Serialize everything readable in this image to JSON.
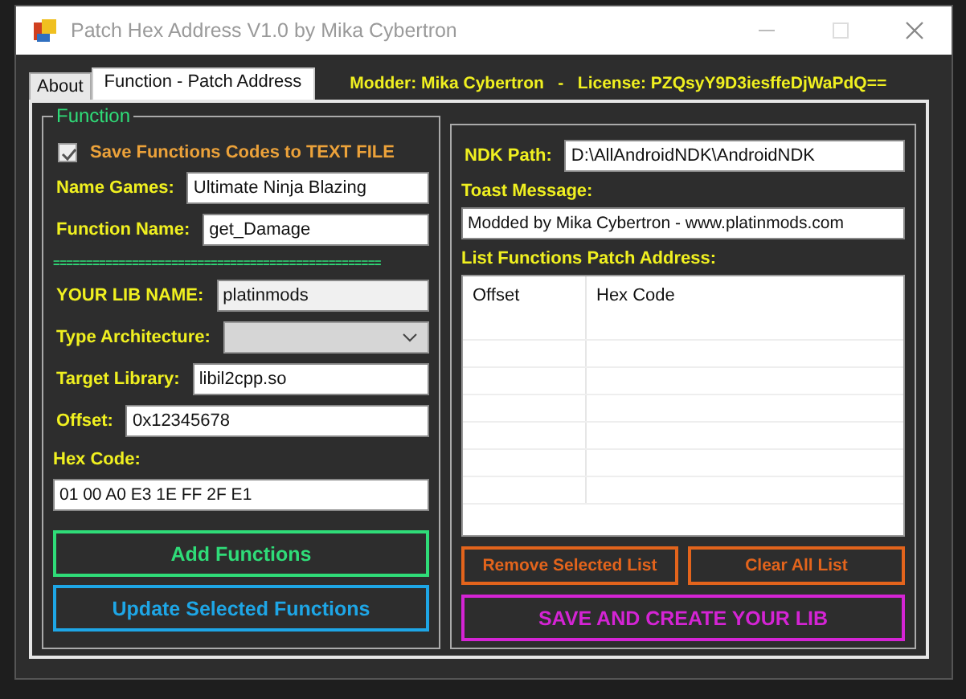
{
  "window": {
    "title": "Patch Hex Address V1.0 by Mika Cybertron"
  },
  "tabs": [
    {
      "label": "About",
      "selected": false
    },
    {
      "label": "Function - Patch Address",
      "selected": true
    }
  ],
  "header_text": "Modder: Mika Cybertron   -   License: PZQsyY9D3iesffeDjWaPdQ==",
  "function_group": {
    "legend": "Function",
    "save_checkbox": {
      "label": "Save Functions Codes to TEXT FILE",
      "checked": true
    },
    "rows": [
      {
        "kind": "field",
        "label": "Name Games:",
        "value": "Ultimate Ninja Blazing",
        "readonly": false
      },
      {
        "kind": "field",
        "label": "Function Name:",
        "value": "get_Damage",
        "readonly": false
      },
      {
        "kind": "separator",
        "text": "=================================================="
      },
      {
        "kind": "field",
        "label": "YOUR LIB NAME:",
        "value": "platinmods",
        "readonly": true
      },
      {
        "kind": "combo",
        "label": "Type Architecture:",
        "disabled": true
      },
      {
        "kind": "field",
        "label": "Target Library:",
        "value": "libil2cpp.so",
        "readonly": false
      },
      {
        "kind": "field",
        "label": "Offset:",
        "value": "0x12345678",
        "readonly": false
      },
      {
        "kind": "stacked",
        "label": "Hex Code:",
        "value": "01 00 A0 E3 1E FF 2F E1",
        "readonly": false
      }
    ],
    "buttons": [
      {
        "label": "Add Functions",
        "color": "#2fdc78"
      },
      {
        "label": "Update Selected Functions",
        "color": "#1ea6e6"
      }
    ]
  },
  "right_panel": {
    "rows": [
      {
        "kind": "field",
        "label": "NDK Path:",
        "value": "D:\\AllAndroidNDK\\AndroidNDK",
        "readonly": false
      },
      {
        "kind": "stacked",
        "label": "Toast Message:",
        "value": "Modded by Mika Cybertron - www.platinmods.com",
        "readonly": false
      }
    ],
    "list_label": "List Functions Patch Address:",
    "table": {
      "columns": [
        "Offset",
        "Hex Code"
      ]
    },
    "buttons": [
      {
        "label": "Remove Selected List",
        "color": "#e3641c"
      },
      {
        "label": "Clear All List",
        "color": "#e3641c"
      }
    ],
    "save_button": {
      "label": "SAVE AND CREATE YOUR LIB",
      "color": "#d424d4"
    }
  }
}
